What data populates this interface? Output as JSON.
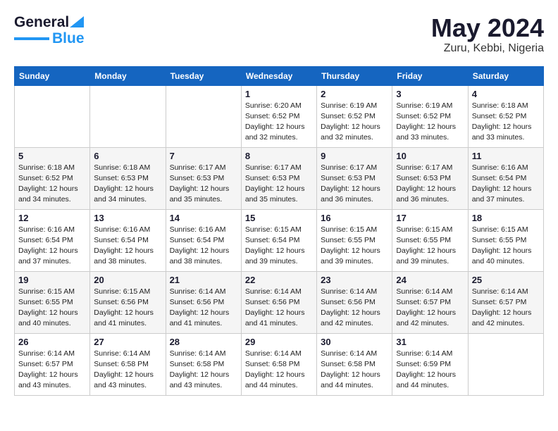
{
  "header": {
    "logo_general": "General",
    "logo_blue": "Blue",
    "title": "May 2024",
    "location": "Zuru, Kebbi, Nigeria"
  },
  "weekdays": [
    "Sunday",
    "Monday",
    "Tuesday",
    "Wednesday",
    "Thursday",
    "Friday",
    "Saturday"
  ],
  "weeks": [
    [
      {
        "day": "",
        "info": ""
      },
      {
        "day": "",
        "info": ""
      },
      {
        "day": "",
        "info": ""
      },
      {
        "day": "1",
        "info": "Sunrise: 6:20 AM\nSunset: 6:52 PM\nDaylight: 12 hours\nand 32 minutes."
      },
      {
        "day": "2",
        "info": "Sunrise: 6:19 AM\nSunset: 6:52 PM\nDaylight: 12 hours\nand 32 minutes."
      },
      {
        "day": "3",
        "info": "Sunrise: 6:19 AM\nSunset: 6:52 PM\nDaylight: 12 hours\nand 33 minutes."
      },
      {
        "day": "4",
        "info": "Sunrise: 6:18 AM\nSunset: 6:52 PM\nDaylight: 12 hours\nand 33 minutes."
      }
    ],
    [
      {
        "day": "5",
        "info": "Sunrise: 6:18 AM\nSunset: 6:52 PM\nDaylight: 12 hours\nand 34 minutes."
      },
      {
        "day": "6",
        "info": "Sunrise: 6:18 AM\nSunset: 6:53 PM\nDaylight: 12 hours\nand 34 minutes."
      },
      {
        "day": "7",
        "info": "Sunrise: 6:17 AM\nSunset: 6:53 PM\nDaylight: 12 hours\nand 35 minutes."
      },
      {
        "day": "8",
        "info": "Sunrise: 6:17 AM\nSunset: 6:53 PM\nDaylight: 12 hours\nand 35 minutes."
      },
      {
        "day": "9",
        "info": "Sunrise: 6:17 AM\nSunset: 6:53 PM\nDaylight: 12 hours\nand 36 minutes."
      },
      {
        "day": "10",
        "info": "Sunrise: 6:17 AM\nSunset: 6:53 PM\nDaylight: 12 hours\nand 36 minutes."
      },
      {
        "day": "11",
        "info": "Sunrise: 6:16 AM\nSunset: 6:54 PM\nDaylight: 12 hours\nand 37 minutes."
      }
    ],
    [
      {
        "day": "12",
        "info": "Sunrise: 6:16 AM\nSunset: 6:54 PM\nDaylight: 12 hours\nand 37 minutes."
      },
      {
        "day": "13",
        "info": "Sunrise: 6:16 AM\nSunset: 6:54 PM\nDaylight: 12 hours\nand 38 minutes."
      },
      {
        "day": "14",
        "info": "Sunrise: 6:16 AM\nSunset: 6:54 PM\nDaylight: 12 hours\nand 38 minutes."
      },
      {
        "day": "15",
        "info": "Sunrise: 6:15 AM\nSunset: 6:54 PM\nDaylight: 12 hours\nand 39 minutes."
      },
      {
        "day": "16",
        "info": "Sunrise: 6:15 AM\nSunset: 6:55 PM\nDaylight: 12 hours\nand 39 minutes."
      },
      {
        "day": "17",
        "info": "Sunrise: 6:15 AM\nSunset: 6:55 PM\nDaylight: 12 hours\nand 39 minutes."
      },
      {
        "day": "18",
        "info": "Sunrise: 6:15 AM\nSunset: 6:55 PM\nDaylight: 12 hours\nand 40 minutes."
      }
    ],
    [
      {
        "day": "19",
        "info": "Sunrise: 6:15 AM\nSunset: 6:55 PM\nDaylight: 12 hours\nand 40 minutes."
      },
      {
        "day": "20",
        "info": "Sunrise: 6:15 AM\nSunset: 6:56 PM\nDaylight: 12 hours\nand 41 minutes."
      },
      {
        "day": "21",
        "info": "Sunrise: 6:14 AM\nSunset: 6:56 PM\nDaylight: 12 hours\nand 41 minutes."
      },
      {
        "day": "22",
        "info": "Sunrise: 6:14 AM\nSunset: 6:56 PM\nDaylight: 12 hours\nand 41 minutes."
      },
      {
        "day": "23",
        "info": "Sunrise: 6:14 AM\nSunset: 6:56 PM\nDaylight: 12 hours\nand 42 minutes."
      },
      {
        "day": "24",
        "info": "Sunrise: 6:14 AM\nSunset: 6:57 PM\nDaylight: 12 hours\nand 42 minutes."
      },
      {
        "day": "25",
        "info": "Sunrise: 6:14 AM\nSunset: 6:57 PM\nDaylight: 12 hours\nand 42 minutes."
      }
    ],
    [
      {
        "day": "26",
        "info": "Sunrise: 6:14 AM\nSunset: 6:57 PM\nDaylight: 12 hours\nand 43 minutes."
      },
      {
        "day": "27",
        "info": "Sunrise: 6:14 AM\nSunset: 6:58 PM\nDaylight: 12 hours\nand 43 minutes."
      },
      {
        "day": "28",
        "info": "Sunrise: 6:14 AM\nSunset: 6:58 PM\nDaylight: 12 hours\nand 43 minutes."
      },
      {
        "day": "29",
        "info": "Sunrise: 6:14 AM\nSunset: 6:58 PM\nDaylight: 12 hours\nand 44 minutes."
      },
      {
        "day": "30",
        "info": "Sunrise: 6:14 AM\nSunset: 6:58 PM\nDaylight: 12 hours\nand 44 minutes."
      },
      {
        "day": "31",
        "info": "Sunrise: 6:14 AM\nSunset: 6:59 PM\nDaylight: 12 hours\nand 44 minutes."
      },
      {
        "day": "",
        "info": ""
      }
    ]
  ]
}
